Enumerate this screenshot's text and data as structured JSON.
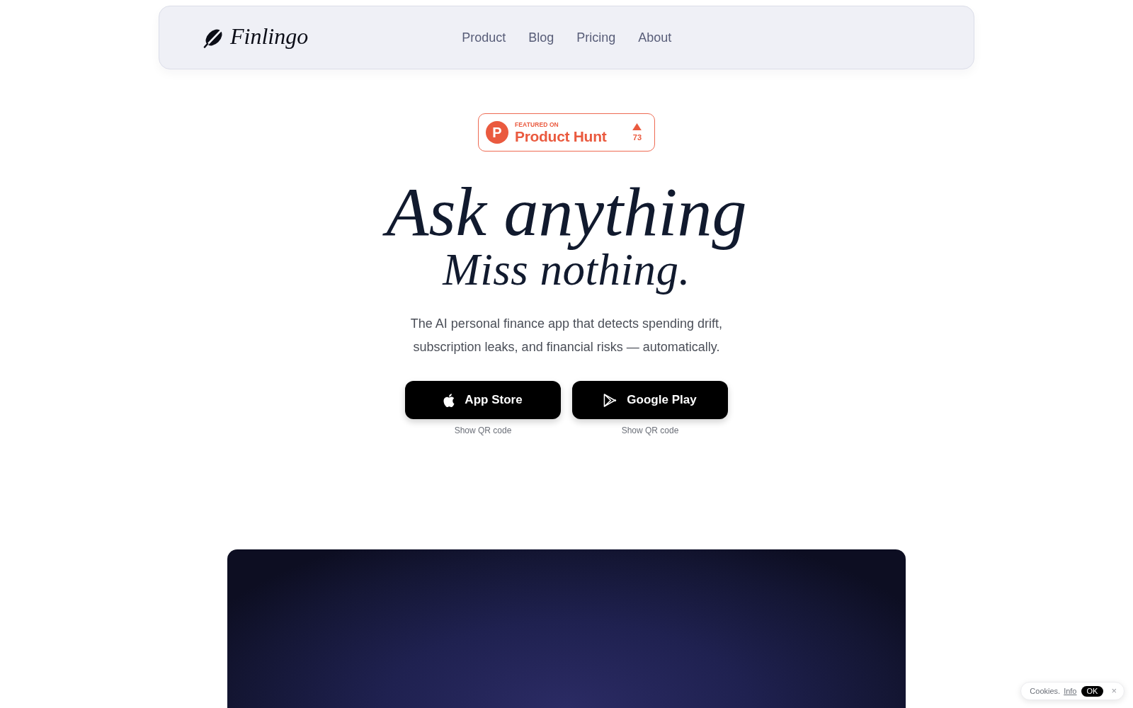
{
  "nav": {
    "brand": "Finlingo",
    "links": [
      {
        "label": "Product"
      },
      {
        "label": "Blog"
      },
      {
        "label": "Pricing"
      },
      {
        "label": "About"
      }
    ]
  },
  "badge": {
    "logo_letter": "P",
    "kicker": "FEATURED ON",
    "name": "Product Hunt",
    "count": "73"
  },
  "hero": {
    "headline": "Ask anything",
    "subheadline": "Miss nothing.",
    "description": "The AI personal finance app that detects spending drift, subscription leaks, and financial risks — automatically."
  },
  "downloads": [
    {
      "kind": "apple",
      "label": "App Store",
      "note": "Show QR code"
    },
    {
      "kind": "google-play",
      "label": "Google Play",
      "note": "Show QR code"
    }
  ],
  "cookie_banner": {
    "text": "Cookies.",
    "link": "Info",
    "accept": "OK",
    "close": "×"
  }
}
